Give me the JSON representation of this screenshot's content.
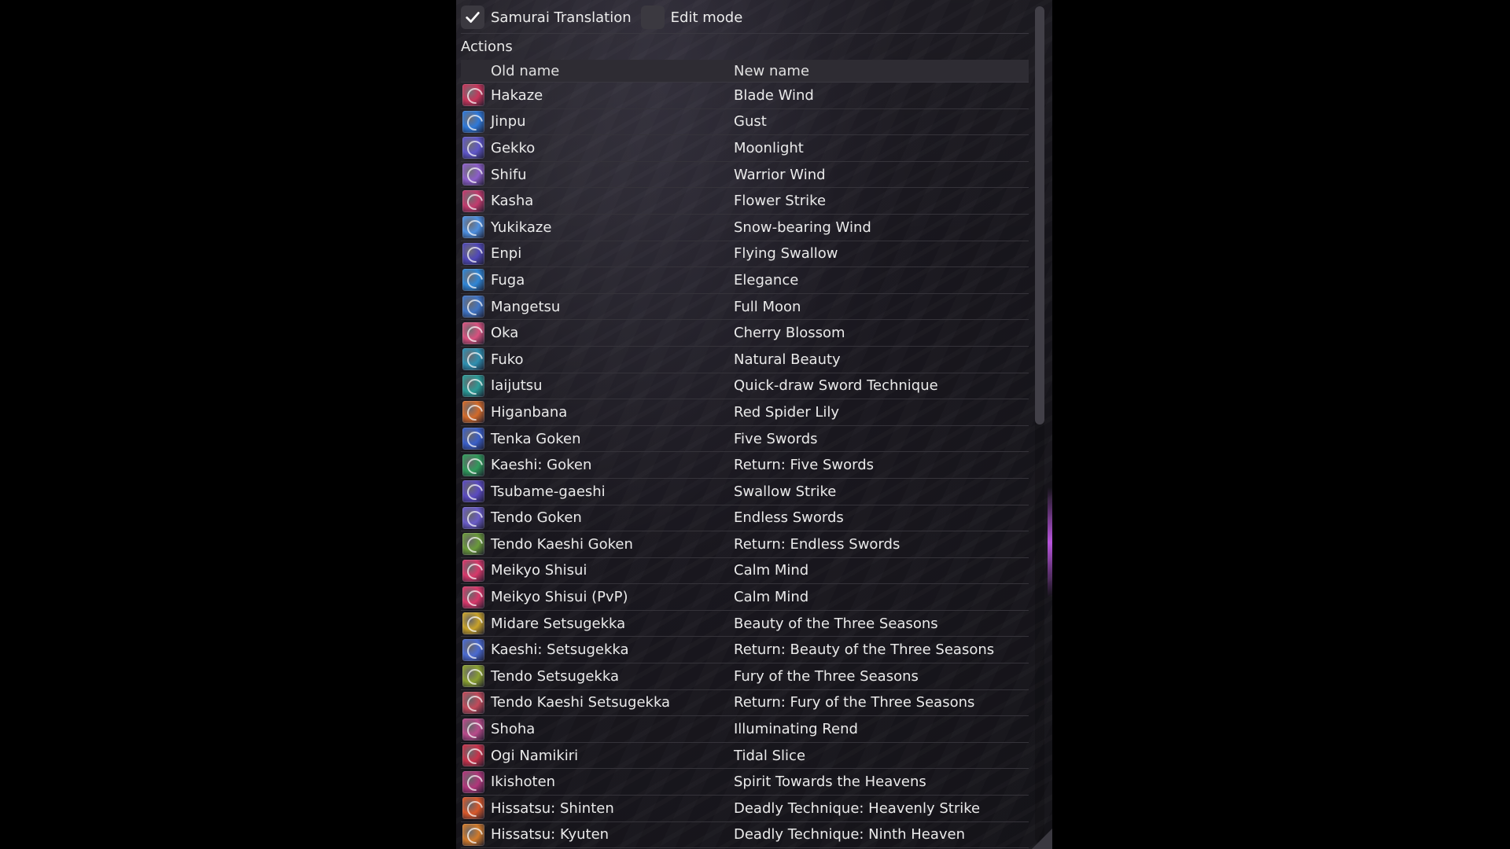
{
  "topbar": {
    "samurai_label": "Samurai Translation",
    "samurai_checked": true,
    "edit_label": "Edit mode",
    "edit_checked": false
  },
  "section_title": "Actions",
  "columns": {
    "old": "Old name",
    "new": "New name"
  },
  "rows": [
    {
      "old": "Hakaze",
      "new": "Blade Wind",
      "icon": "hakaze-icon",
      "color": "#c7355a"
    },
    {
      "old": "Jinpu",
      "new": "Gust",
      "icon": "jinpu-icon",
      "color": "#2e78d8"
    },
    {
      "old": "Gekko",
      "new": "Moonlight",
      "icon": "gekko-icon",
      "color": "#5f56c9"
    },
    {
      "old": "Shifu",
      "new": "Warrior Wind",
      "icon": "shifu-icon",
      "color": "#8c5ec9"
    },
    {
      "old": "Kasha",
      "new": "Flower Strike",
      "icon": "kasha-icon",
      "color": "#c23a6d"
    },
    {
      "old": "Yukikaze",
      "new": "Snow-bearing Wind",
      "icon": "yukikaze-icon",
      "color": "#4d8fe0"
    },
    {
      "old": "Enpi",
      "new": "Flying Swallow",
      "icon": "enpi-icon",
      "color": "#5048b8"
    },
    {
      "old": "Fuga",
      "new": "Elegance",
      "icon": "fuga-icon",
      "color": "#2f86d6"
    },
    {
      "old": "Mangetsu",
      "new": "Full Moon",
      "icon": "mangetsu-icon",
      "color": "#3f74c4"
    },
    {
      "old": "Oka",
      "new": "Cherry Blossom",
      "icon": "oka-icon",
      "color": "#d8527f"
    },
    {
      "old": "Fuko",
      "new": "Natural Beauty",
      "icon": "fuko-icon",
      "color": "#2e8fb0"
    },
    {
      "old": "Iaijutsu",
      "new": "Quick-draw Sword Technique",
      "icon": "iaijutsu-icon",
      "color": "#2a9a96"
    },
    {
      "old": "Higanbana",
      "new": "Red Spider Lily",
      "icon": "higanbana-icon",
      "color": "#d26a2a"
    },
    {
      "old": "Tenka Goken",
      "new": "Five Swords",
      "icon": "tenka-goken-icon",
      "color": "#3a5fc8"
    },
    {
      "old": "Kaeshi: Goken",
      "new": "Return: Five Swords",
      "icon": "kaeshi-goken-icon",
      "color": "#2f9a5a"
    },
    {
      "old": "Tsubame-gaeshi",
      "new": "Swallow Strike",
      "icon": "tsubame-gaeshi-icon",
      "color": "#5a4ac0"
    },
    {
      "old": "Tendo Goken",
      "new": "Endless Swords",
      "icon": "tendo-goken-icon",
      "color": "#6a5cc8"
    },
    {
      "old": "Tendo Kaeshi Goken",
      "new": "Return: Endless Swords",
      "icon": "tendo-kaeshi-goken-icon",
      "color": "#6a9a3a"
    },
    {
      "old": "Meikyo Shisui",
      "new": "Calm Mind",
      "icon": "meikyo-shisui-icon",
      "color": "#d8386a"
    },
    {
      "old": "Meikyo Shisui (PvP)",
      "new": "Calm Mind",
      "icon": "meikyo-shisui-pvp-icon",
      "color": "#d8386a"
    },
    {
      "old": "Midare Setsugekka",
      "new": "Beauty of the Three Seasons",
      "icon": "midare-setsugekka-icon",
      "color": "#c8a22a"
    },
    {
      "old": "Kaeshi: Setsugekka",
      "new": "Return: Beauty of the Three Seasons",
      "icon": "kaeshi-setsugekka-icon",
      "color": "#4a6ad0"
    },
    {
      "old": "Tendo Setsugekka",
      "new": "Fury of the Three Seasons",
      "icon": "tendo-setsugekka-icon",
      "color": "#8aa030"
    },
    {
      "old": "Tendo Kaeshi Setsugekka",
      "new": "Return: Fury of the Three Seasons",
      "icon": "tendo-kaeshi-setsugekka-icon",
      "color": "#c24a5a"
    },
    {
      "old": "Shoha",
      "new": "Illuminating Rend",
      "icon": "shoha-icon",
      "color": "#b84a8a"
    },
    {
      "old": "Ogi Namikiri",
      "new": "Tidal Slice",
      "icon": "ogi-namikiri-icon",
      "color": "#c8324a"
    },
    {
      "old": "Ikishoten",
      "new": "Spirit Towards the Heavens",
      "icon": "ikishoten-icon",
      "color": "#b0367a"
    },
    {
      "old": "Hissatsu: Shinten",
      "new": "Deadly Technique: Heavenly Strike",
      "icon": "hissatsu-shinten-icon",
      "color": "#d8582a"
    },
    {
      "old": "Hissatsu: Kyuten",
      "new": "Deadly Technique: Ninth Heaven",
      "icon": "hissatsu-kyuten-icon",
      "color": "#d07a2a"
    }
  ]
}
